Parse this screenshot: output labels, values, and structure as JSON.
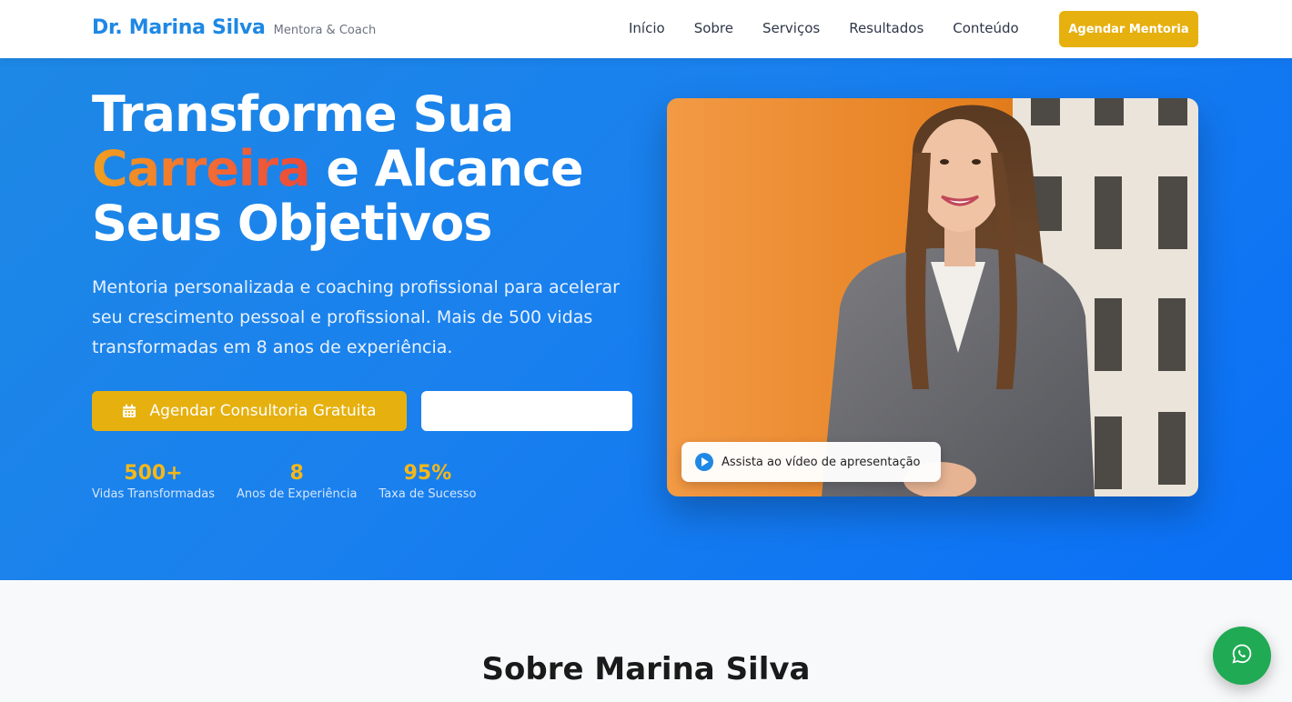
{
  "brand": {
    "name": "Dr. Marina Silva",
    "tagline": "Mentora & Coach"
  },
  "nav": {
    "links": [
      "Início",
      "Sobre",
      "Serviços",
      "Resultados",
      "Conteúdo"
    ],
    "cta": "Agendar Mentoria"
  },
  "hero": {
    "title_line1": "Transforme Sua",
    "title_highlight": "Carreira",
    "title_after_highlight": " e Alcance",
    "title_line3": "Seus Objetivos",
    "subtitle": "Mentoria personalizada e coaching profissional para acelerar seu crescimento pessoal e profissional. Mais de 500 vidas transformadas em 8 anos de experiência.",
    "primary_cta": "Agendar Consultoria Gratuita",
    "secondary_cta": "",
    "stats": [
      {
        "value": "500+",
        "label": "Vidas Transformadas"
      },
      {
        "value": "8",
        "label": "Anos de Experiência"
      },
      {
        "value": "95%",
        "label": "Taxa de Sucesso"
      }
    ],
    "video_label": "Assista ao vídeo de apresentação"
  },
  "about": {
    "title": "Sobre Marina Silva"
  },
  "colors": {
    "primary": "#1e88e5",
    "accent": "#e6b00e",
    "stat": "#f5b819",
    "whatsapp": "#1faa53"
  },
  "icons": {
    "primary_cta": "calendar-icon",
    "video": "play-icon",
    "floating": "whatsapp-icon"
  }
}
